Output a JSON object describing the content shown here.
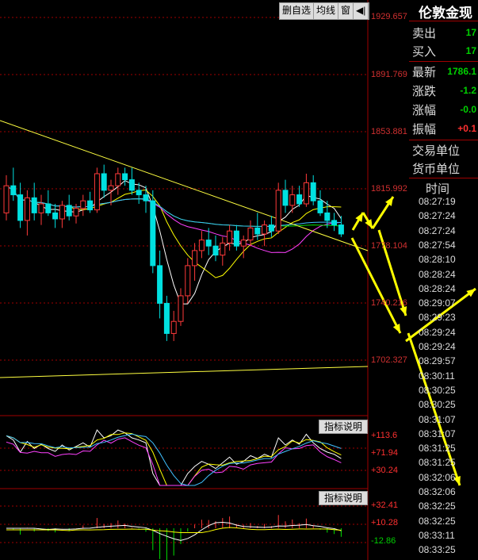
{
  "toolbar": {
    "btn1": "删自选",
    "btn2": "均线",
    "btn3": "窗",
    "btn4_icon": "exit-icon"
  },
  "price_axis": [
    "1929.657",
    "1891.769",
    "1853.881",
    "1815.992",
    "1778.104",
    "1740.216",
    "1702.327"
  ],
  "indicator1": {
    "button": "指标说明",
    "axis": [
      "+113.6",
      "+71.94",
      "+30.24"
    ]
  },
  "indicator2": {
    "button": "指标说明",
    "axis": [
      "+32.41",
      "+10.28",
      "-12.86"
    ]
  },
  "quote": {
    "title": "伦敦金现",
    "sell_label": "卖出",
    "sell_value": "17",
    "buy_label": "买入",
    "buy_value": "17",
    "last_label": "最新",
    "last_value": "1786.1",
    "change_label": "涨跌",
    "change_value": "-1.2",
    "pct_label": "涨幅",
    "pct_value": "-0.0",
    "amp_label": "振幅",
    "amp_value": "+0.1",
    "unit_label": "交易单位",
    "currency_label": "货币单位"
  },
  "time_header": "时间",
  "times": [
    "08:27:19",
    "08:27:24",
    "08:27:24",
    "08:27:54",
    "08:28:10",
    "08:28:24",
    "08:28:24",
    "08:29:07",
    "08:29:23",
    "08:29:24",
    "08:29:24",
    "08:29:57",
    "08:30:11",
    "08:30:25",
    "08:30:25",
    "08:31:07",
    "08:31:07",
    "08:31:25",
    "08:31:25",
    "08:32:06",
    "08:32:06",
    "08:32:25",
    "08:32:25",
    "08:33:11",
    "08:33:25"
  ],
  "chart_data": {
    "type": "candlestick",
    "ylim": [
      1702.327,
      1929.657
    ],
    "ohlc": [
      [
        1800,
        1825,
        1795,
        1818
      ],
      [
        1818,
        1830,
        1808,
        1812
      ],
      [
        1812,
        1820,
        1790,
        1795
      ],
      [
        1795,
        1815,
        1785,
        1810
      ],
      [
        1810,
        1820,
        1795,
        1800
      ],
      [
        1800,
        1812,
        1792,
        1806
      ],
      [
        1806,
        1815,
        1798,
        1800
      ],
      [
        1800,
        1806,
        1790,
        1796
      ],
      [
        1796,
        1808,
        1790,
        1805
      ],
      [
        1805,
        1812,
        1795,
        1798
      ],
      [
        1798,
        1806,
        1793,
        1803
      ],
      [
        1803,
        1812,
        1798,
        1808
      ],
      [
        1808,
        1814,
        1800,
        1802
      ],
      [
        1802,
        1830,
        1800,
        1826
      ],
      [
        1826,
        1832,
        1810,
        1815
      ],
      [
        1815,
        1822,
        1805,
        1818
      ],
      [
        1818,
        1830,
        1812,
        1826
      ],
      [
        1826,
        1830,
        1818,
        1822
      ],
      [
        1822,
        1830,
        1812,
        1815
      ],
      [
        1815,
        1820,
        1806,
        1812
      ],
      [
        1812,
        1818,
        1800,
        1808
      ],
      [
        1808,
        1815,
        1760,
        1765
      ],
      [
        1765,
        1775,
        1730,
        1740
      ],
      [
        1740,
        1745,
        1715,
        1720
      ],
      [
        1720,
        1735,
        1715,
        1728
      ],
      [
        1728,
        1750,
        1725,
        1745
      ],
      [
        1745,
        1770,
        1740,
        1765
      ],
      [
        1765,
        1780,
        1755,
        1775
      ],
      [
        1775,
        1788,
        1770,
        1782
      ],
      [
        1782,
        1790,
        1772,
        1778
      ],
      [
        1778,
        1785,
        1768,
        1772
      ],
      [
        1772,
        1784,
        1765,
        1780
      ],
      [
        1780,
        1792,
        1775,
        1788
      ],
      [
        1788,
        1792,
        1775,
        1778
      ],
      [
        1778,
        1785,
        1770,
        1782
      ],
      [
        1782,
        1795,
        1778,
        1790
      ],
      [
        1790,
        1800,
        1782,
        1786
      ],
      [
        1786,
        1795,
        1778,
        1792
      ],
      [
        1792,
        1798,
        1784,
        1788
      ],
      [
        1788,
        1820,
        1786,
        1815
      ],
      [
        1815,
        1822,
        1800,
        1805
      ],
      [
        1805,
        1818,
        1800,
        1812
      ],
      [
        1812,
        1818,
        1804,
        1806
      ],
      [
        1806,
        1826,
        1804,
        1820
      ],
      [
        1820,
        1825,
        1805,
        1808
      ],
      [
        1808,
        1815,
        1798,
        1800
      ],
      [
        1800,
        1808,
        1790,
        1795
      ],
      [
        1795,
        1800,
        1788,
        1792
      ],
      [
        1792,
        1798,
        1784,
        1786
      ]
    ]
  }
}
